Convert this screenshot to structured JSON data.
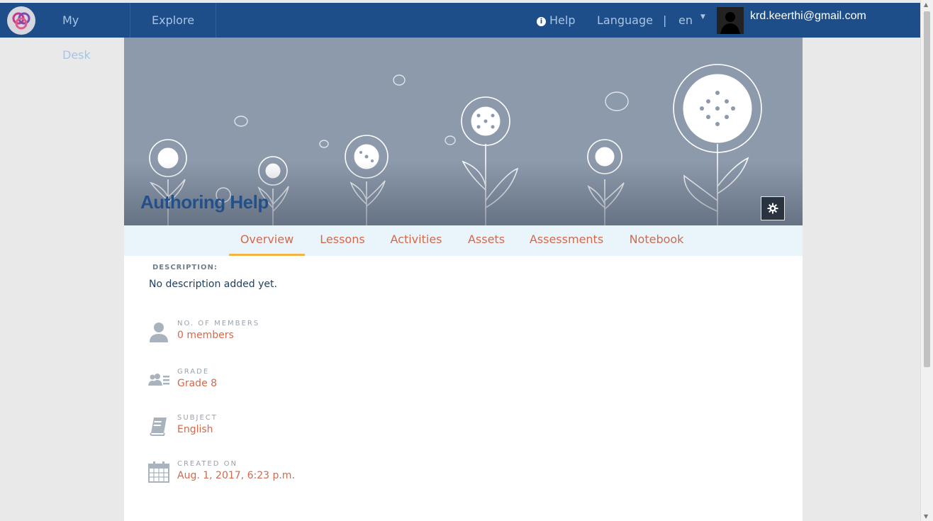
{
  "nav": {
    "my_desk": "My Desk",
    "explore": "Explore",
    "help": "Help",
    "language_label": "Language",
    "separator": "|",
    "language_value": "en",
    "user_email": "krd.keerthi@gmail.com"
  },
  "banner": {
    "title": "Authoring Help"
  },
  "tabs": [
    {
      "label": "Overview",
      "active": true
    },
    {
      "label": "Lessons",
      "active": false
    },
    {
      "label": "Activities",
      "active": false
    },
    {
      "label": "Assets",
      "active": false
    },
    {
      "label": "Assessments",
      "active": false
    },
    {
      "label": "Notebook",
      "active": false
    }
  ],
  "description": {
    "label": "DESCRIPTION:",
    "text": "No description added yet."
  },
  "details": {
    "members": {
      "label": "NO. OF MEMBERS",
      "value": "0 members",
      "icon": "person-icon"
    },
    "grade": {
      "label": "GRADE",
      "value": "Grade 8",
      "icon": "group-icon"
    },
    "subject": {
      "label": "SUBJECT",
      "value": "English",
      "icon": "book-icon"
    },
    "created": {
      "label": "CREATED ON",
      "value": "Aug. 1, 2017, 6:23 p.m.",
      "icon": "calendar-icon"
    }
  },
  "colors": {
    "nav_bg": "#1d4e89",
    "accent": "#d2694d",
    "tab_underline": "#f4b547",
    "banner_bg": "#8d9aac"
  }
}
